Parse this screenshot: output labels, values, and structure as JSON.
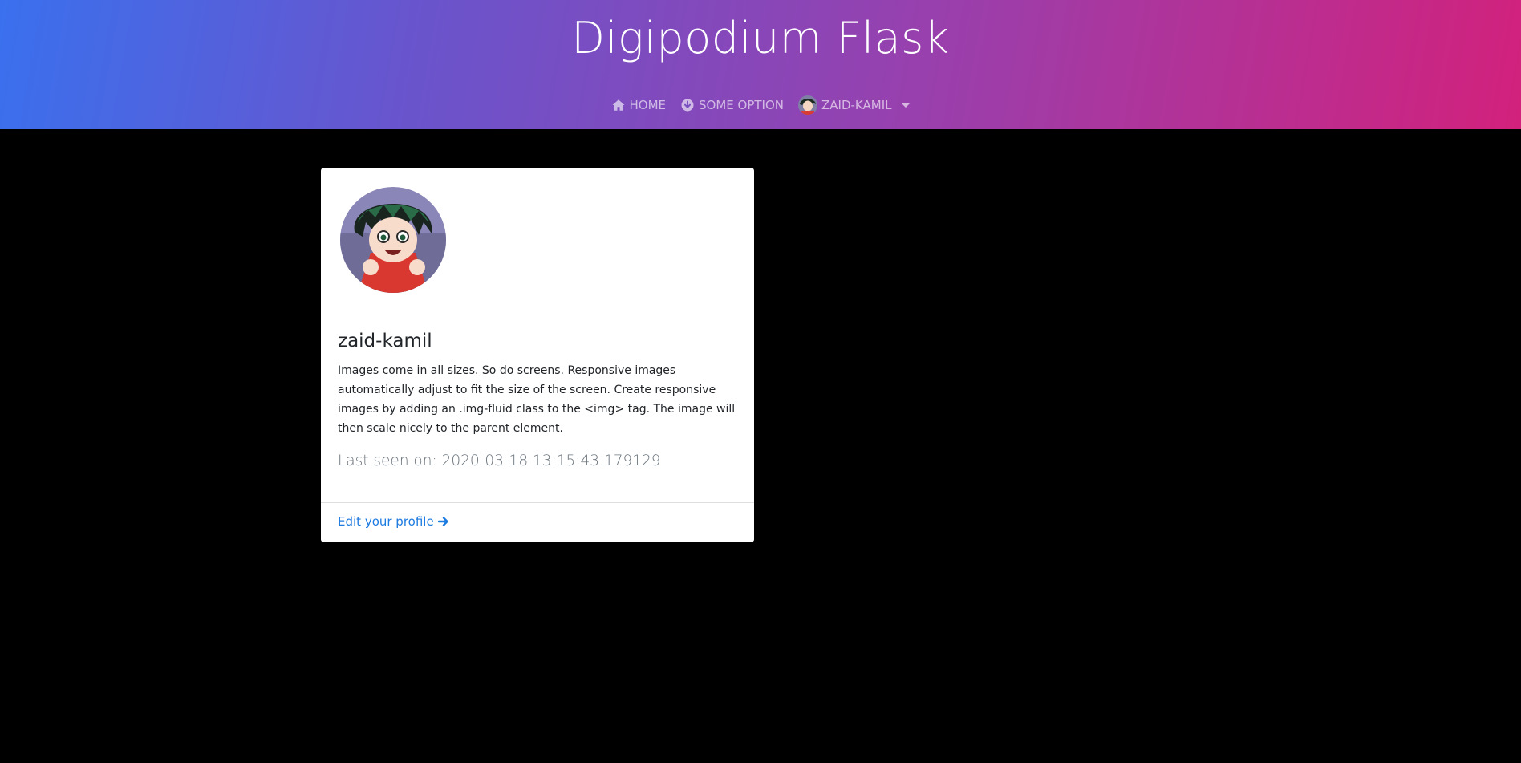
{
  "header": {
    "brand": "Digipodium Flask",
    "nav": {
      "home_label": "HOME",
      "option_label": "SOME OPTION",
      "user_label": "ZAID-KAMIL"
    },
    "gradient_colors": [
      "#3a70ee",
      "#6a54cc",
      "#9a3fac",
      "#d2217c"
    ]
  },
  "profile": {
    "username": "zaid-kamil",
    "bio": "Images come in all sizes. So do screens. Responsive images automatically adjust to fit the size of the screen. Create responsive images by adding an .img-fluid class to the <img> tag. The image will then scale nicely to the parent element.",
    "last_seen": "Last seen on: 2020-03-18 13:15:43.179129",
    "edit_link": "Edit your profile"
  },
  "icons": {
    "home": "home-icon",
    "option": "arrow-circle-down-icon",
    "avatar": "avatar",
    "dropdown": "caret-down-icon",
    "edit": "arrow-right-icon"
  },
  "colors": {
    "background": "#000000",
    "card": "#ffffff",
    "link": "#1e7be0",
    "muted": "#6c757d"
  }
}
